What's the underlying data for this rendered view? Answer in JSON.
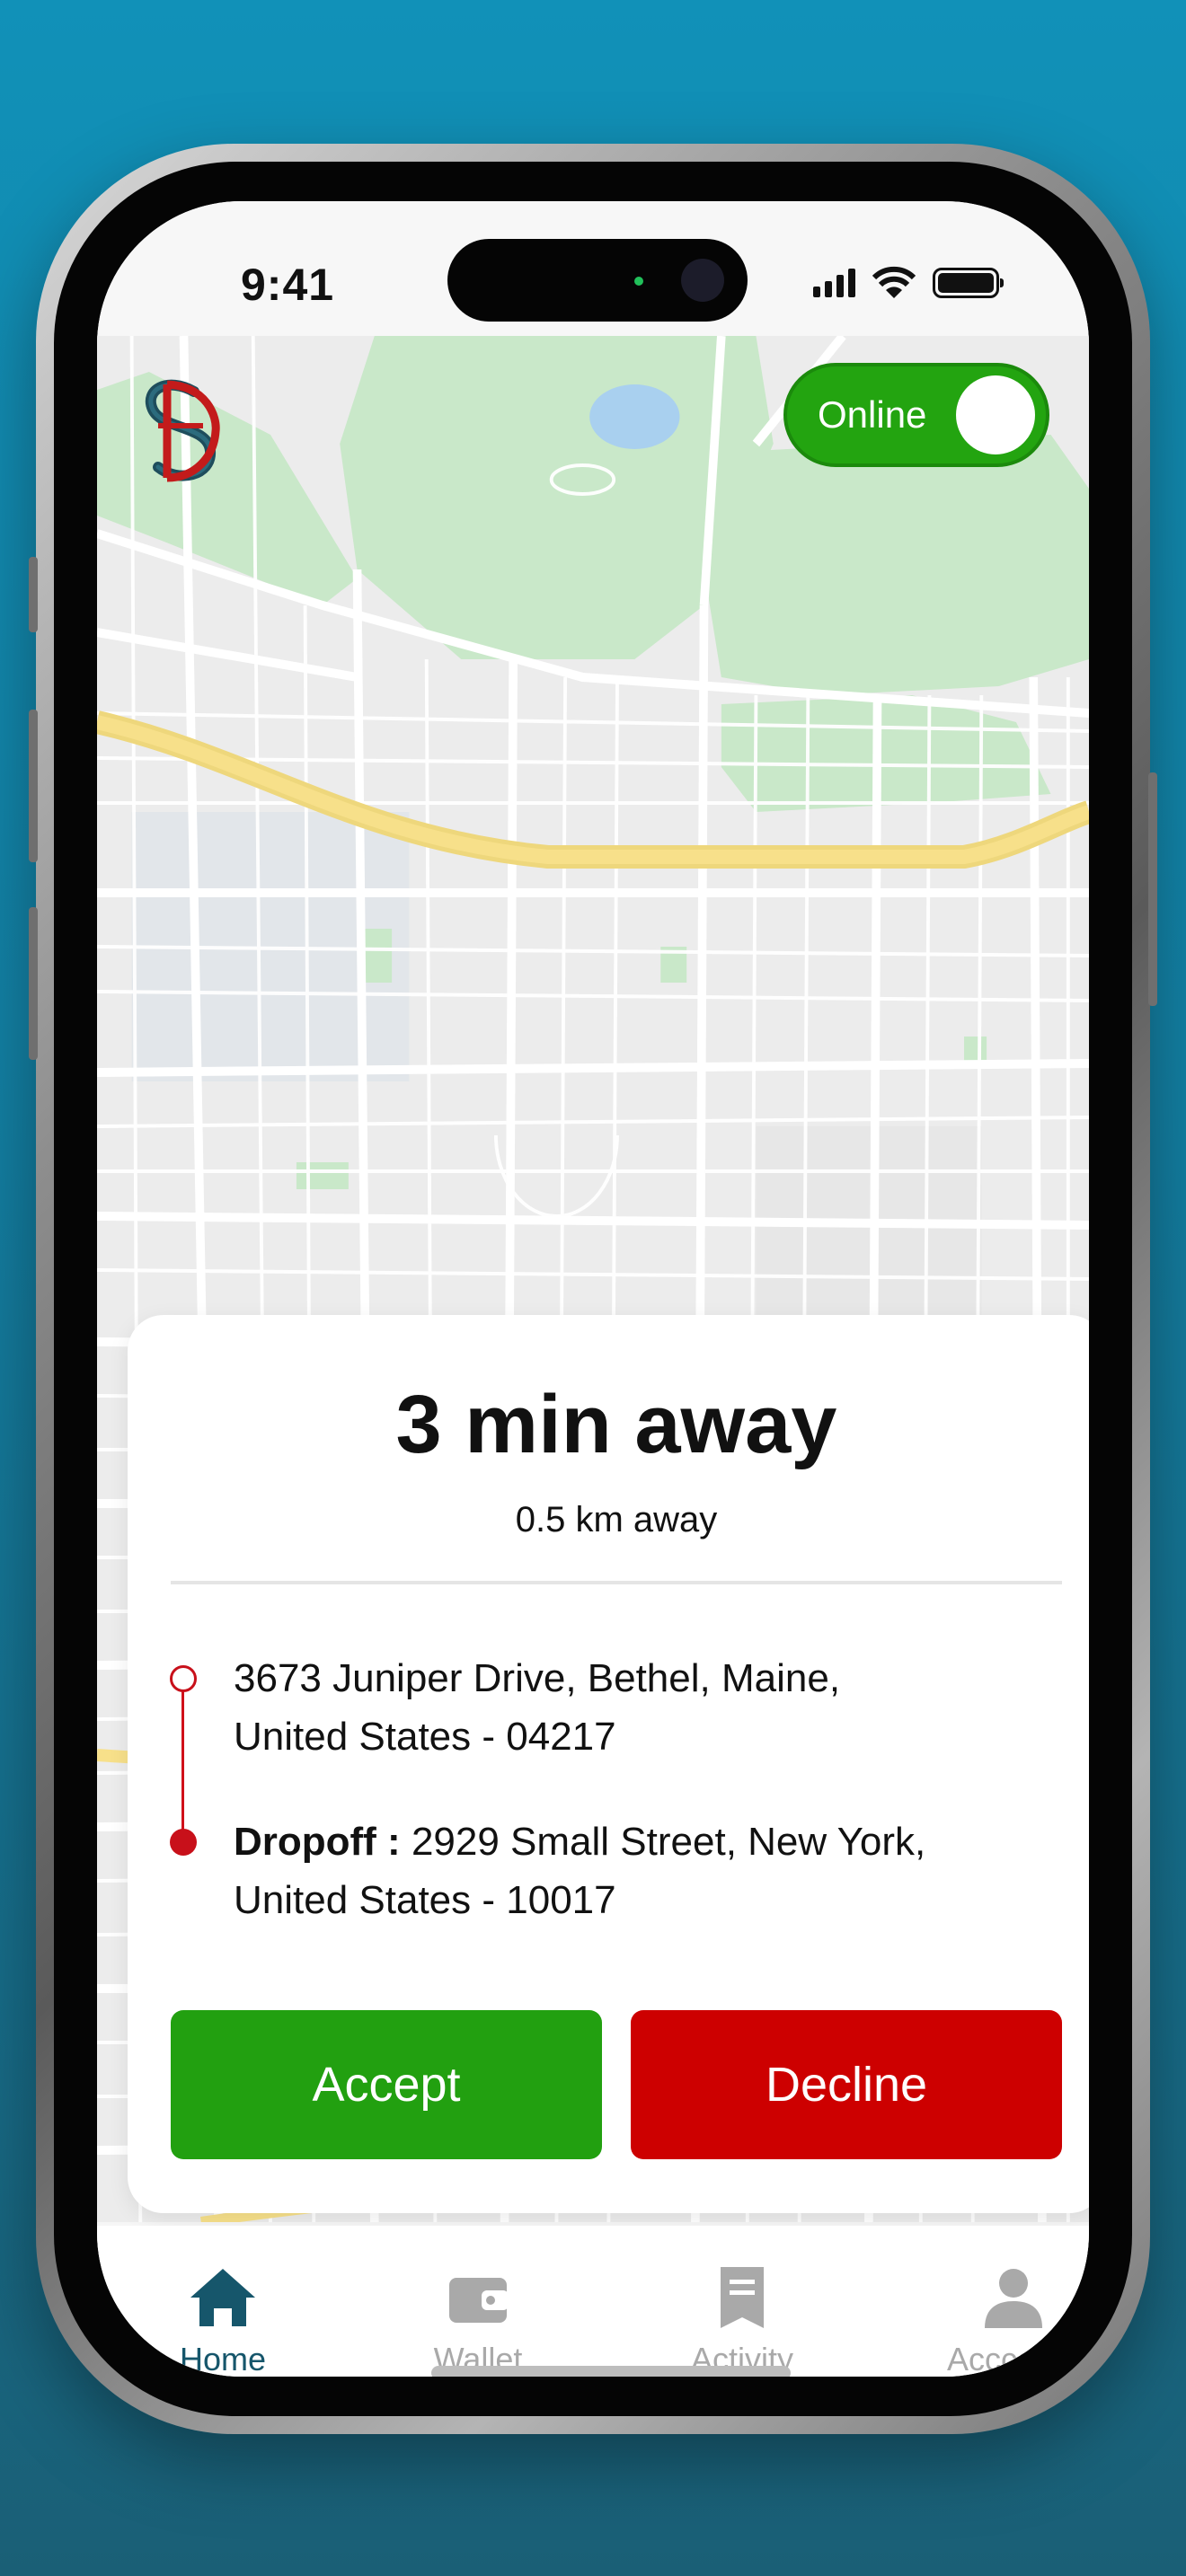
{
  "status_bar": {
    "time": "9:41",
    "icons": [
      "cellular-signal-icon",
      "wifi-icon",
      "battery-icon"
    ]
  },
  "header": {
    "logo": "monogram-logo",
    "online_toggle": {
      "label": "Online",
      "state": "on",
      "color": "#23a410"
    }
  },
  "ride_request": {
    "eta": "3 min away",
    "distance": "0.5 km away",
    "pickup": {
      "address": "3673 Juniper Drive, Bethel, Maine, United States - 04217"
    },
    "dropoff": {
      "label": "Dropoff :",
      "address": " 2929 Small Street, New York, United States - 10017"
    },
    "actions": {
      "accept": {
        "label": "Accept",
        "color": "#22a010"
      },
      "decline": {
        "label": "Decline",
        "color": "#cd0000"
      }
    }
  },
  "tabbar": {
    "items": [
      {
        "label": "Home",
        "icon": "home-icon",
        "active": true
      },
      {
        "label": "Wallet",
        "icon": "wallet-icon",
        "active": false
      },
      {
        "label": "Activity",
        "icon": "receipt-icon",
        "active": false
      },
      {
        "label": "Acccount",
        "icon": "user-icon",
        "active": false
      }
    ]
  },
  "colors": {
    "background": "#1191b8",
    "accent": "#16566b",
    "map_park": "#c9e8c9",
    "map_highway": "#f7e08a",
    "route": "#c8101a"
  }
}
